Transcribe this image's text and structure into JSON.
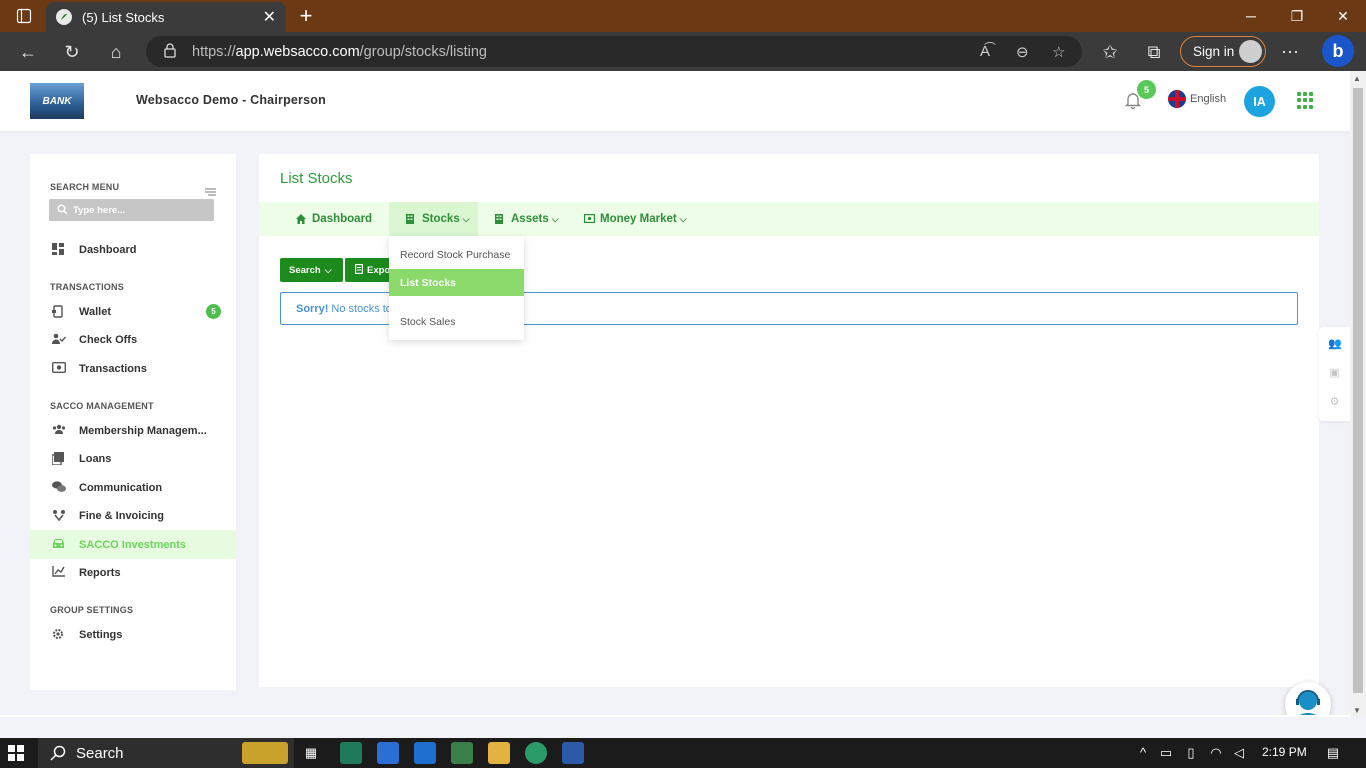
{
  "browser": {
    "tab_title": "(5) List Stocks",
    "url_prefix": "https://",
    "url_host": "app.websacco.com",
    "url_path": "/group/stocks/listing",
    "signin_label": "Sign in"
  },
  "header": {
    "org_name": "Websacco Demo - Chairperson",
    "notification_count": "5",
    "language": "English",
    "user_initials": "IA"
  },
  "sidebar": {
    "search_label": "SEARCH MENU",
    "search_placeholder": "Type here...",
    "dashboard": "Dashboard",
    "section_transactions": "TRANSACTIONS",
    "wallet": "Wallet",
    "wallet_badge": "5",
    "check_offs": "Check Offs",
    "transactions": "Transactions",
    "section_sacco": "SACCO MANAGEMENT",
    "membership": "Membership Managem...",
    "loans": "Loans",
    "communication": "Communication",
    "fine_invoicing": "Fine & Invoicing",
    "sacco_investments": "SACCO Investments",
    "reports": "Reports",
    "section_group": "GROUP SETTINGS",
    "settings": "Settings"
  },
  "main": {
    "title": "List Stocks",
    "subnav": {
      "dashboard": "Dashboard",
      "stocks": "Stocks",
      "assets": "Assets",
      "money_market": "Money Market"
    },
    "search_button": "Search",
    "export_button": "Expo",
    "alert_strong": "Sorry!",
    "alert_text": "No stocks to",
    "stocks_menu": [
      "Record Stock Purchase",
      "List Stocks",
      "Stock Sales"
    ]
  },
  "taskbar": {
    "search_label": "Search",
    "time": "2:19 PM"
  },
  "colors": {
    "brand_green": "#2e9a3d",
    "button_green": "#1d8a1d",
    "active_green": "#8ad96a",
    "alert_blue": "#4a93d6",
    "avatar_blue": "#1ca4e0"
  }
}
